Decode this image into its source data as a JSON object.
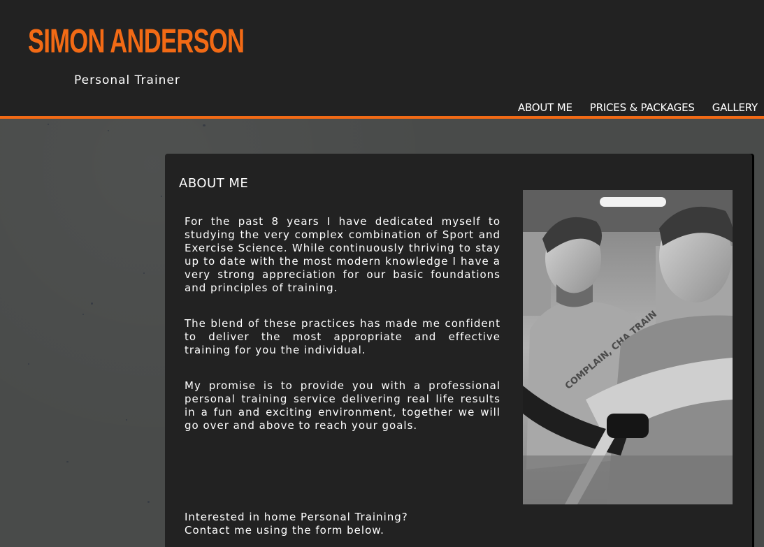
{
  "header": {
    "title": "SIMON ANDERSON",
    "subtitle": "Personal Trainer"
  },
  "nav": {
    "items": [
      {
        "label": "ABOUT ME"
      },
      {
        "label": "PRICES & PACKAGES"
      },
      {
        "label": "GALLERY"
      }
    ]
  },
  "colors": {
    "accent": "#f26a15",
    "header_background": "#222222",
    "panel_background": "#222222",
    "page_background": "#494b4a"
  },
  "about": {
    "heading": "ABOUT ME",
    "paragraphs": [
      "For the past 8 years I have dedicated myself to studying the very complex combination of Sport and Exercise Science. While continuously thriving to stay up to date with the most modern knowledge I have a very strong appreciation for our basic foundations and principles of training.",
      "The blend of these practices has made me confident to deliver the most appropriate and effective training for you the individual.",
      "My promise is to provide you with a professional personal training service delivering real life results in a fun and exciting environment, together we will go over and above to reach your goals."
    ],
    "cta_lines": [
      "Interested in home Personal Training?",
      "Contact me using the form below."
    ],
    "photo_shirt_text": "COMPLAIN, CHA TRAIN"
  }
}
